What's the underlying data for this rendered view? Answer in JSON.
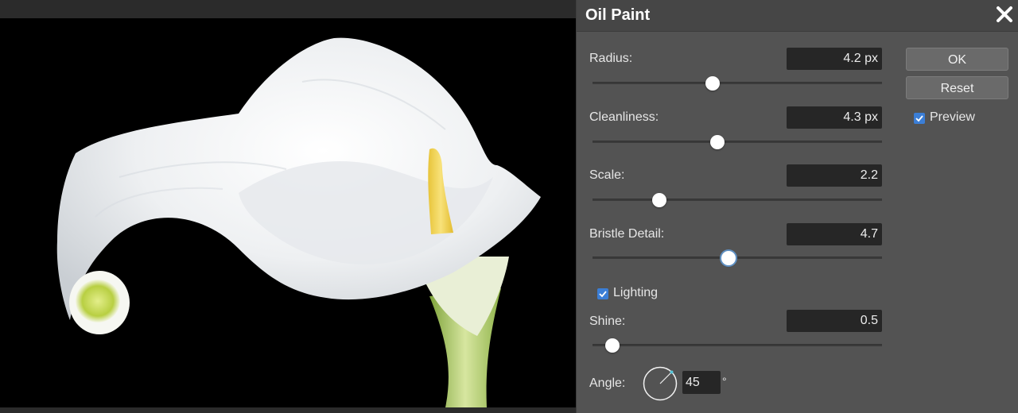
{
  "dialog": {
    "title": "Oil Paint",
    "ok_label": "OK",
    "reset_label": "Reset",
    "preview_label": "Preview",
    "preview_checked": true
  },
  "controls": {
    "radius": {
      "label": "Radius:",
      "value": "4.2 px",
      "level": 0.415
    },
    "cleanliness": {
      "label": "Cleanliness:",
      "value": "4.3 px",
      "level": 0.43
    },
    "scale": {
      "label": "Scale:",
      "value": "2.2",
      "level": 0.23
    },
    "bristle": {
      "label": "Bristle Detail:",
      "value": "4.7",
      "level": 0.47
    },
    "lighting": {
      "label": "Lighting",
      "checked": true
    },
    "shine": {
      "label": "Shine:",
      "value": "0.5",
      "level": 0.07
    },
    "angle": {
      "label": "Angle:",
      "value": "45",
      "unit": "°"
    }
  },
  "colors": {
    "panel": "#535353",
    "field": "#262626",
    "accent": "#3b7ed6",
    "angle_indicator": "#58c8dc"
  },
  "icons": {
    "close": "close-icon",
    "check": "checkmark-icon"
  }
}
